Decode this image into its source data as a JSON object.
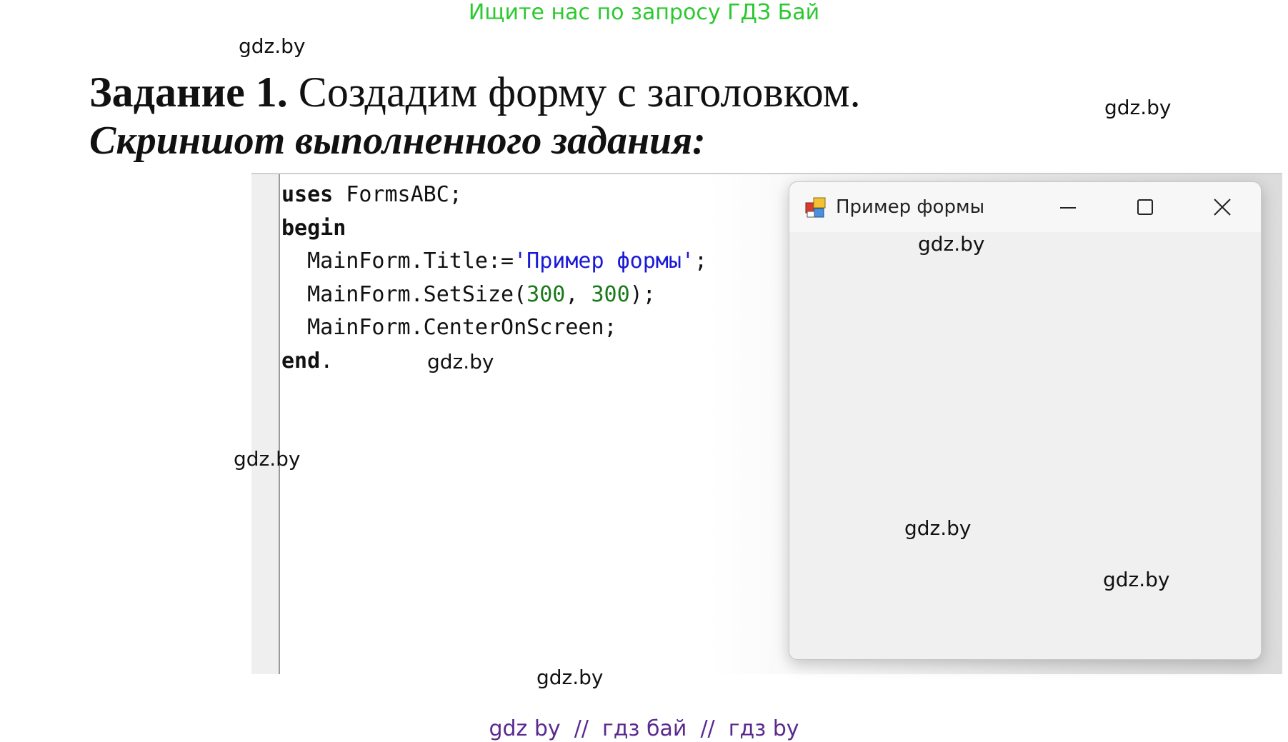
{
  "banner": "Ищите нас по запросу ГДЗ Бай",
  "watermark": "gdz.by",
  "task": {
    "label": "Задание 1.",
    "text": " Создадим форму с заголовком.",
    "subtitle": "Скриншот выполненного задания:"
  },
  "code": {
    "line1_kw": "uses",
    "line1_rest": " FormsABC;",
    "line2_kw": "begin",
    "line3_a": "  MainForm.Title:=",
    "line3_str": "'Пример формы'",
    "line3_b": ";",
    "line4_a": "  MainForm.SetSize(",
    "line4_n1": "300",
    "line4_b": ", ",
    "line4_n2": "300",
    "line4_c": ");",
    "line5": "  MainForm.CenterOnScreen;",
    "line6_kw": "end",
    "line6_rest": "."
  },
  "form_window": {
    "title": "Пример формы",
    "icon": "app-form-icon",
    "buttons": [
      "minimize-icon",
      "maximize-icon",
      "close-icon"
    ]
  },
  "footer": "gdz by  //  гдз бай  //  гдз by"
}
